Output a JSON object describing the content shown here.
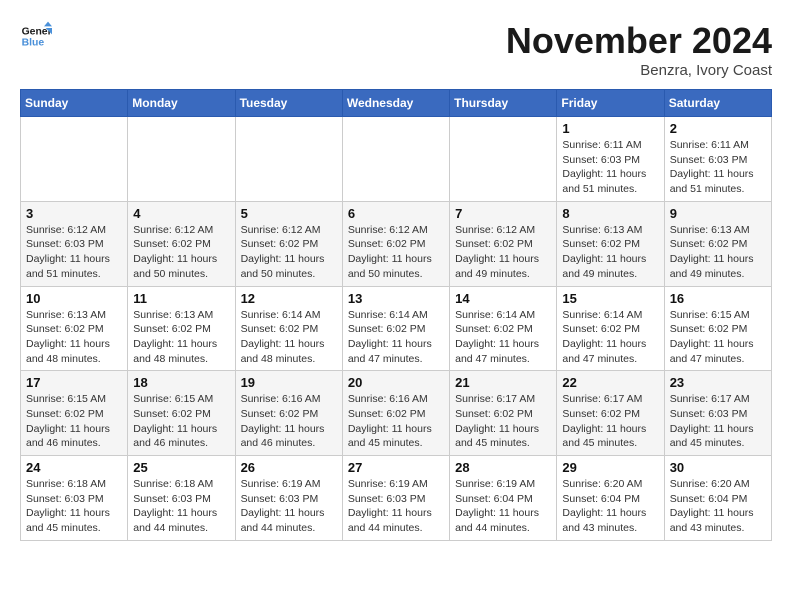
{
  "logo": {
    "text_general": "General",
    "text_blue": "Blue"
  },
  "title": "November 2024",
  "location": "Benzra, Ivory Coast",
  "days_header": [
    "Sunday",
    "Monday",
    "Tuesday",
    "Wednesday",
    "Thursday",
    "Friday",
    "Saturday"
  ],
  "weeks": [
    [
      {
        "day": "",
        "info": ""
      },
      {
        "day": "",
        "info": ""
      },
      {
        "day": "",
        "info": ""
      },
      {
        "day": "",
        "info": ""
      },
      {
        "day": "",
        "info": ""
      },
      {
        "day": "1",
        "info": "Sunrise: 6:11 AM\nSunset: 6:03 PM\nDaylight: 11 hours and 51 minutes."
      },
      {
        "day": "2",
        "info": "Sunrise: 6:11 AM\nSunset: 6:03 PM\nDaylight: 11 hours and 51 minutes."
      }
    ],
    [
      {
        "day": "3",
        "info": "Sunrise: 6:12 AM\nSunset: 6:03 PM\nDaylight: 11 hours and 51 minutes."
      },
      {
        "day": "4",
        "info": "Sunrise: 6:12 AM\nSunset: 6:02 PM\nDaylight: 11 hours and 50 minutes."
      },
      {
        "day": "5",
        "info": "Sunrise: 6:12 AM\nSunset: 6:02 PM\nDaylight: 11 hours and 50 minutes."
      },
      {
        "day": "6",
        "info": "Sunrise: 6:12 AM\nSunset: 6:02 PM\nDaylight: 11 hours and 50 minutes."
      },
      {
        "day": "7",
        "info": "Sunrise: 6:12 AM\nSunset: 6:02 PM\nDaylight: 11 hours and 49 minutes."
      },
      {
        "day": "8",
        "info": "Sunrise: 6:13 AM\nSunset: 6:02 PM\nDaylight: 11 hours and 49 minutes."
      },
      {
        "day": "9",
        "info": "Sunrise: 6:13 AM\nSunset: 6:02 PM\nDaylight: 11 hours and 49 minutes."
      }
    ],
    [
      {
        "day": "10",
        "info": "Sunrise: 6:13 AM\nSunset: 6:02 PM\nDaylight: 11 hours and 48 minutes."
      },
      {
        "day": "11",
        "info": "Sunrise: 6:13 AM\nSunset: 6:02 PM\nDaylight: 11 hours and 48 minutes."
      },
      {
        "day": "12",
        "info": "Sunrise: 6:14 AM\nSunset: 6:02 PM\nDaylight: 11 hours and 48 minutes."
      },
      {
        "day": "13",
        "info": "Sunrise: 6:14 AM\nSunset: 6:02 PM\nDaylight: 11 hours and 47 minutes."
      },
      {
        "day": "14",
        "info": "Sunrise: 6:14 AM\nSunset: 6:02 PM\nDaylight: 11 hours and 47 minutes."
      },
      {
        "day": "15",
        "info": "Sunrise: 6:14 AM\nSunset: 6:02 PM\nDaylight: 11 hours and 47 minutes."
      },
      {
        "day": "16",
        "info": "Sunrise: 6:15 AM\nSunset: 6:02 PM\nDaylight: 11 hours and 47 minutes."
      }
    ],
    [
      {
        "day": "17",
        "info": "Sunrise: 6:15 AM\nSunset: 6:02 PM\nDaylight: 11 hours and 46 minutes."
      },
      {
        "day": "18",
        "info": "Sunrise: 6:15 AM\nSunset: 6:02 PM\nDaylight: 11 hours and 46 minutes."
      },
      {
        "day": "19",
        "info": "Sunrise: 6:16 AM\nSunset: 6:02 PM\nDaylight: 11 hours and 46 minutes."
      },
      {
        "day": "20",
        "info": "Sunrise: 6:16 AM\nSunset: 6:02 PM\nDaylight: 11 hours and 45 minutes."
      },
      {
        "day": "21",
        "info": "Sunrise: 6:17 AM\nSunset: 6:02 PM\nDaylight: 11 hours and 45 minutes."
      },
      {
        "day": "22",
        "info": "Sunrise: 6:17 AM\nSunset: 6:02 PM\nDaylight: 11 hours and 45 minutes."
      },
      {
        "day": "23",
        "info": "Sunrise: 6:17 AM\nSunset: 6:03 PM\nDaylight: 11 hours and 45 minutes."
      }
    ],
    [
      {
        "day": "24",
        "info": "Sunrise: 6:18 AM\nSunset: 6:03 PM\nDaylight: 11 hours and 45 minutes."
      },
      {
        "day": "25",
        "info": "Sunrise: 6:18 AM\nSunset: 6:03 PM\nDaylight: 11 hours and 44 minutes."
      },
      {
        "day": "26",
        "info": "Sunrise: 6:19 AM\nSunset: 6:03 PM\nDaylight: 11 hours and 44 minutes."
      },
      {
        "day": "27",
        "info": "Sunrise: 6:19 AM\nSunset: 6:03 PM\nDaylight: 11 hours and 44 minutes."
      },
      {
        "day": "28",
        "info": "Sunrise: 6:19 AM\nSunset: 6:04 PM\nDaylight: 11 hours and 44 minutes."
      },
      {
        "day": "29",
        "info": "Sunrise: 6:20 AM\nSunset: 6:04 PM\nDaylight: 11 hours and 43 minutes."
      },
      {
        "day": "30",
        "info": "Sunrise: 6:20 AM\nSunset: 6:04 PM\nDaylight: 11 hours and 43 minutes."
      }
    ]
  ]
}
